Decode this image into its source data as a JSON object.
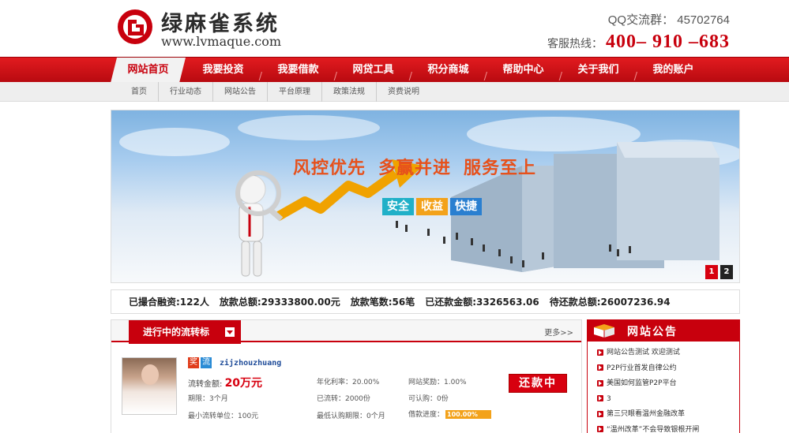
{
  "header": {
    "logo_cn": "绿麻雀系统",
    "logo_url": "www.lvmaque.com",
    "qq": "QQ交流群： 45702764",
    "hotline_label": "客服热线：",
    "hotline_number": "400– 910 –683"
  },
  "nav": {
    "items": [
      "网站首页",
      "我要投资",
      "我要借款",
      "网贷工具",
      "积分商城",
      "帮助中心",
      "关于我们",
      "我的账户"
    ],
    "active_index": 0
  },
  "subnav": {
    "items": [
      "首页",
      "行业动态",
      "网站公告",
      "平台原理",
      "政策法规",
      "资费说明"
    ]
  },
  "banner": {
    "slogan": [
      "风控优先",
      "多赢并进",
      "服务至上"
    ],
    "tags": [
      "安全",
      "收益",
      "快捷"
    ],
    "pages": [
      "1",
      "2"
    ],
    "active_page": "1"
  },
  "stats": {
    "items": [
      "已撮合融资:122人",
      "放款总额:29333800.00元",
      "放款笔数:56笔",
      "已还款金额:3326563.06",
      "待还款总额:26007236.94"
    ]
  },
  "loan_panel": {
    "tab_label": "进行中的流转标",
    "more_label": "更多>>",
    "badges": [
      "奖",
      "流"
    ],
    "username": "zijzhouzhuang",
    "amount_label": "流转金额:",
    "amount_value": "20万元",
    "term": "期限：3个月",
    "min_unit": "最小流转单位：100元",
    "annual_rate": "年化利率：20.00%",
    "transferred": "已流转：2000份",
    "min_period": "最低认购期限：0个月",
    "reward": "网站奖励：1.00%",
    "available": "可认购：0份",
    "progress_label": "借款进度：",
    "progress_text": "100.00%",
    "progress_value": 1.0,
    "action_label": "还款中"
  },
  "notice": {
    "title": "网站公告",
    "items": [
      "网站公告测试 欢迎测试",
      "P2P行业首发自律公约",
      "美国如何监管P2P平台",
      "3",
      "第三只眼看温州金融改革",
      "“温州改革”不会导致银根开闸"
    ]
  },
  "colors": {
    "brand_red": "#c8000d",
    "orange": "#f3a21a"
  }
}
